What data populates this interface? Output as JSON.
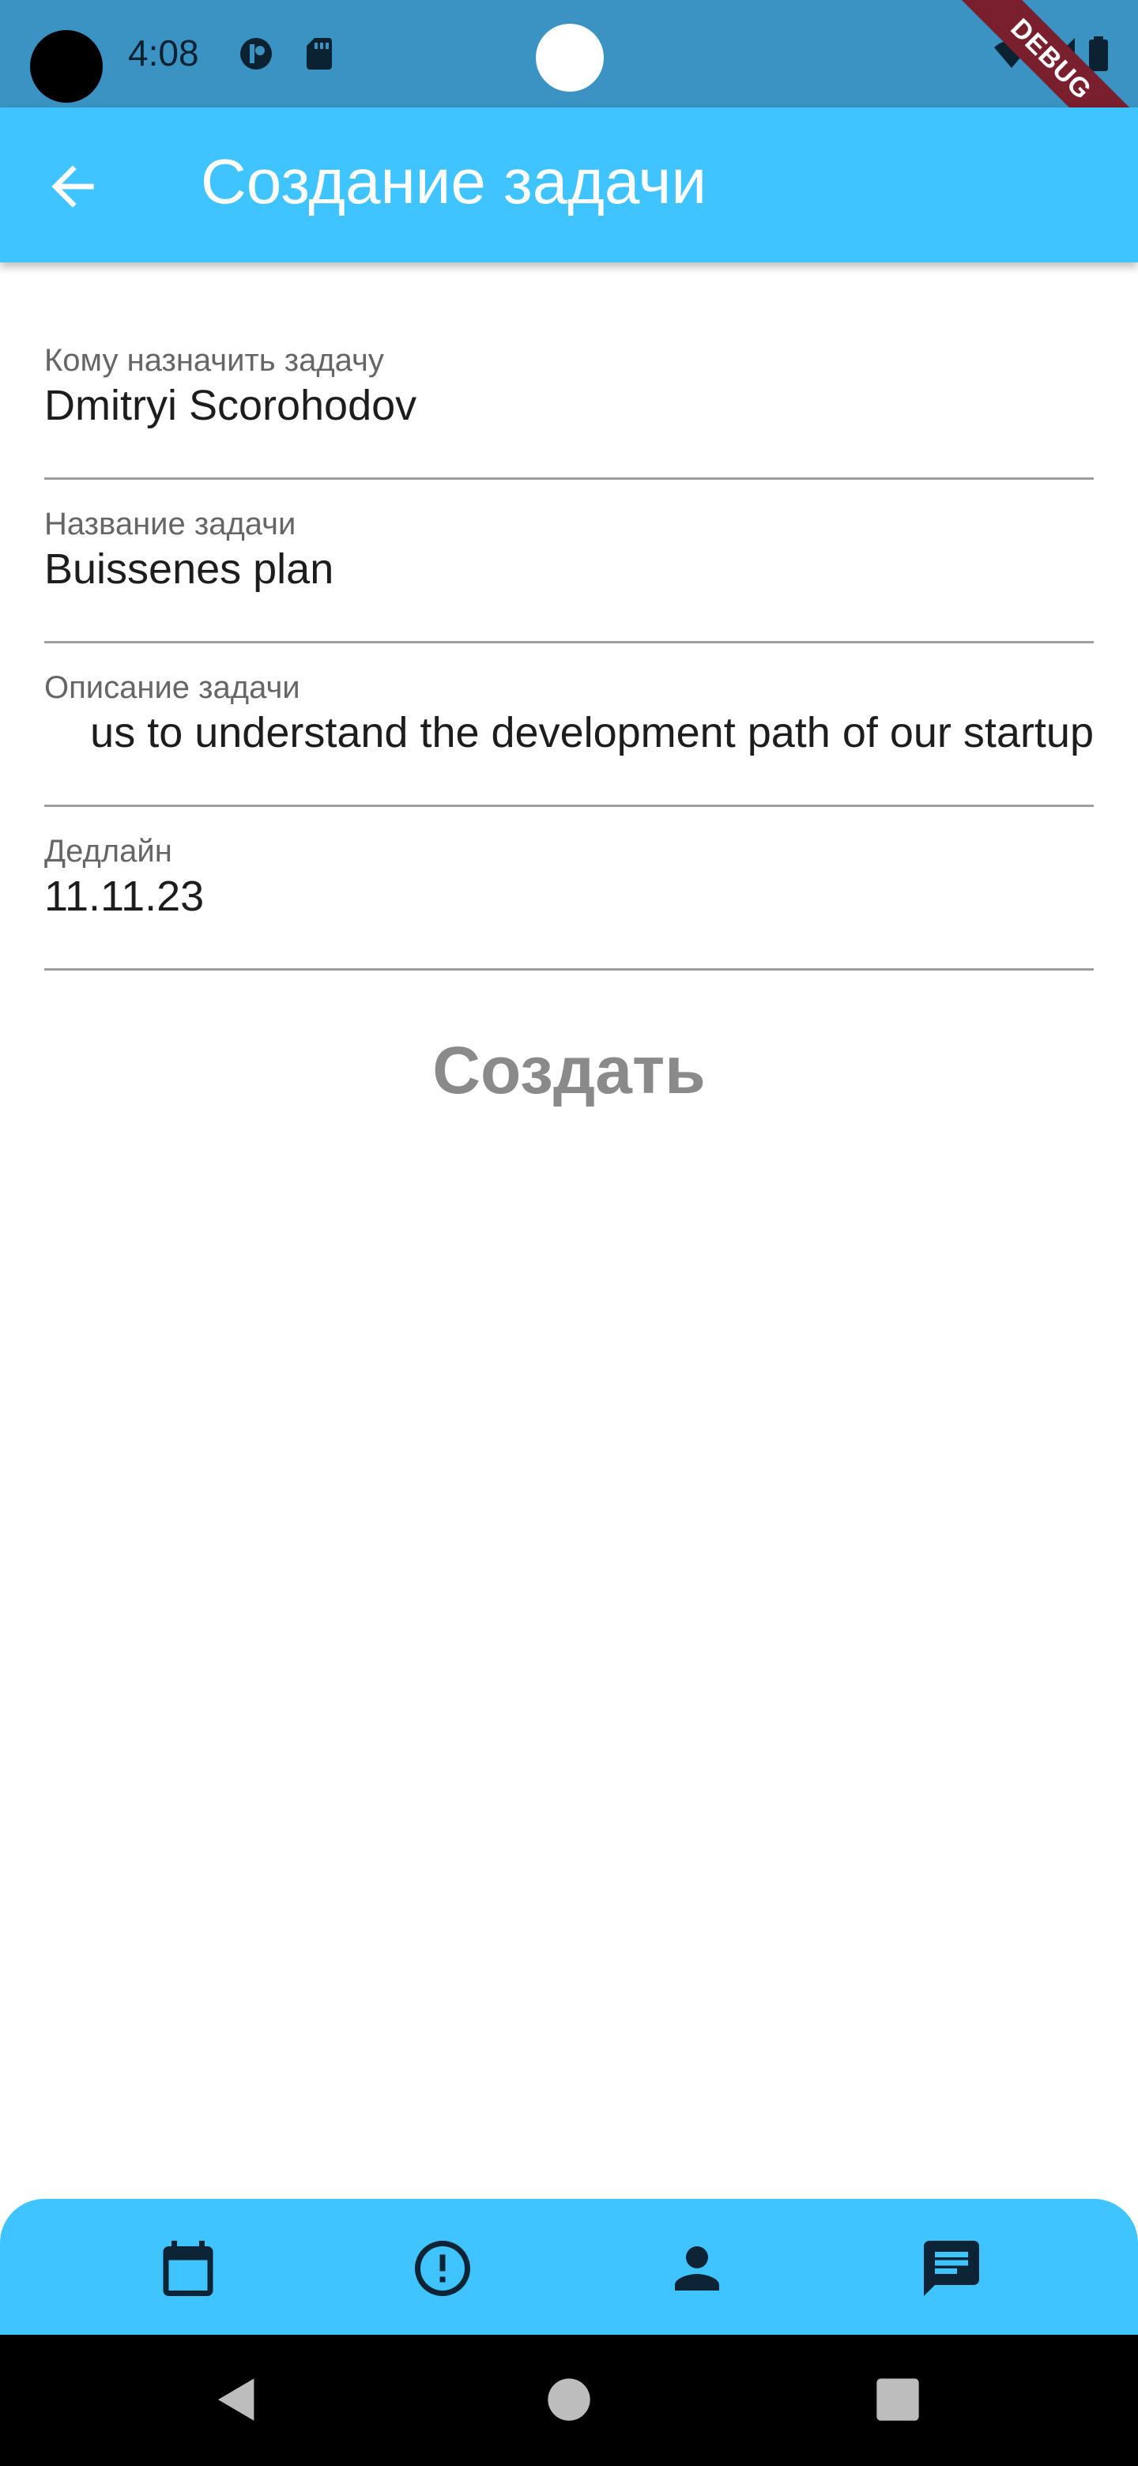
{
  "status_bar": {
    "time": "4:08",
    "debug_label": "DEBUG",
    "icons": [
      "app-notification-icon",
      "sd-card-icon",
      "wifi-icon",
      "signal-icon",
      "battery-icon"
    ]
  },
  "app_bar": {
    "title": "Создание задачи",
    "back_icon": "arrow-back-icon",
    "color": "#40c4ff"
  },
  "form": {
    "fields": [
      {
        "label": "Кому назначить задачу",
        "value": "Dmitryi Scorohodov"
      },
      {
        "label": "Название задачи",
        "value": "Buissenes plan"
      },
      {
        "label": "Описание задачи",
        "value": "us to understand the development path of our startup"
      },
      {
        "label": "Дедлайн",
        "value": "11.11.23"
      }
    ],
    "submit_label": "Создать"
  },
  "bottom_nav": {
    "items": [
      {
        "icon": "calendar-icon"
      },
      {
        "icon": "alert-circle-icon"
      },
      {
        "icon": "person-icon"
      },
      {
        "icon": "chat-icon"
      }
    ]
  },
  "system_nav": {
    "icons": [
      "back-triangle-icon",
      "home-circle-icon",
      "recents-square-icon"
    ]
  }
}
